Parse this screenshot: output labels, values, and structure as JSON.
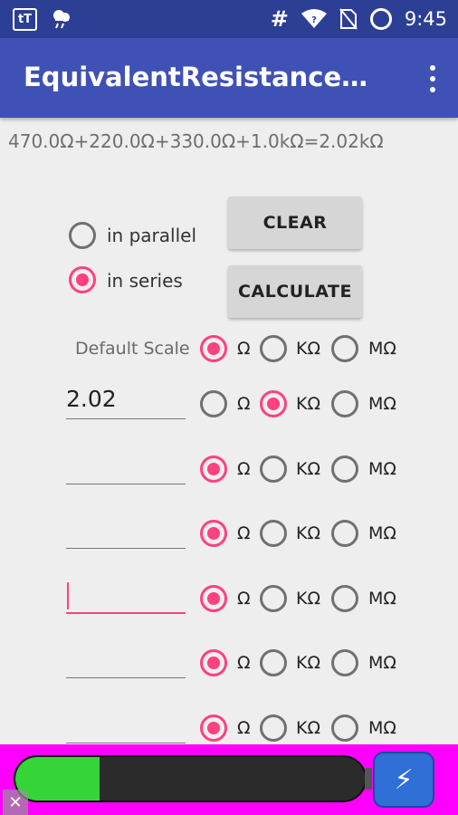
{
  "status_bar": {
    "time": "9:45",
    "left_icons": [
      "tt-app-icon",
      "weather-icon"
    ],
    "right_icons": [
      "hash-icon",
      "wifi-icon",
      "no-sim-icon",
      "battery-saver-icon"
    ],
    "hash_glyph": "#",
    "tt_glyph": "tT"
  },
  "app_bar": {
    "title": "EquivalentResistanceCalculator",
    "menu_icon": "overflow-menu-icon"
  },
  "result_text": "470.0Ω+220.0Ω+330.0Ω+1.0kΩ=2.02kΩ",
  "mode": {
    "options": [
      {
        "label": "in parallel",
        "selected": false
      },
      {
        "label": "in series",
        "selected": true
      }
    ]
  },
  "buttons": {
    "clear": "CLEAR",
    "calculate": "CALCULATE"
  },
  "default_scale": {
    "label": "Default Scale",
    "selected": "Ω"
  },
  "units": [
    "Ω",
    "KΩ",
    "MΩ"
  ],
  "rows": [
    {
      "value": "2.02",
      "selected": "KΩ",
      "focused": false
    },
    {
      "value": "",
      "selected": "Ω",
      "focused": false
    },
    {
      "value": "",
      "selected": "Ω",
      "focused": false
    },
    {
      "value": "",
      "selected": "Ω",
      "focused": true
    },
    {
      "value": "",
      "selected": "Ω",
      "focused": false
    },
    {
      "value": "",
      "selected": "Ω",
      "focused": false
    }
  ],
  "ad": {
    "close_glyph": "✕",
    "battery_level": 0.24,
    "colors": {
      "background": "#ff00ff",
      "fill": "#35d53a"
    }
  },
  "colors": {
    "primary": "#3f51b5",
    "primary_dark": "#2c3f95",
    "accent": "#ff4081"
  }
}
